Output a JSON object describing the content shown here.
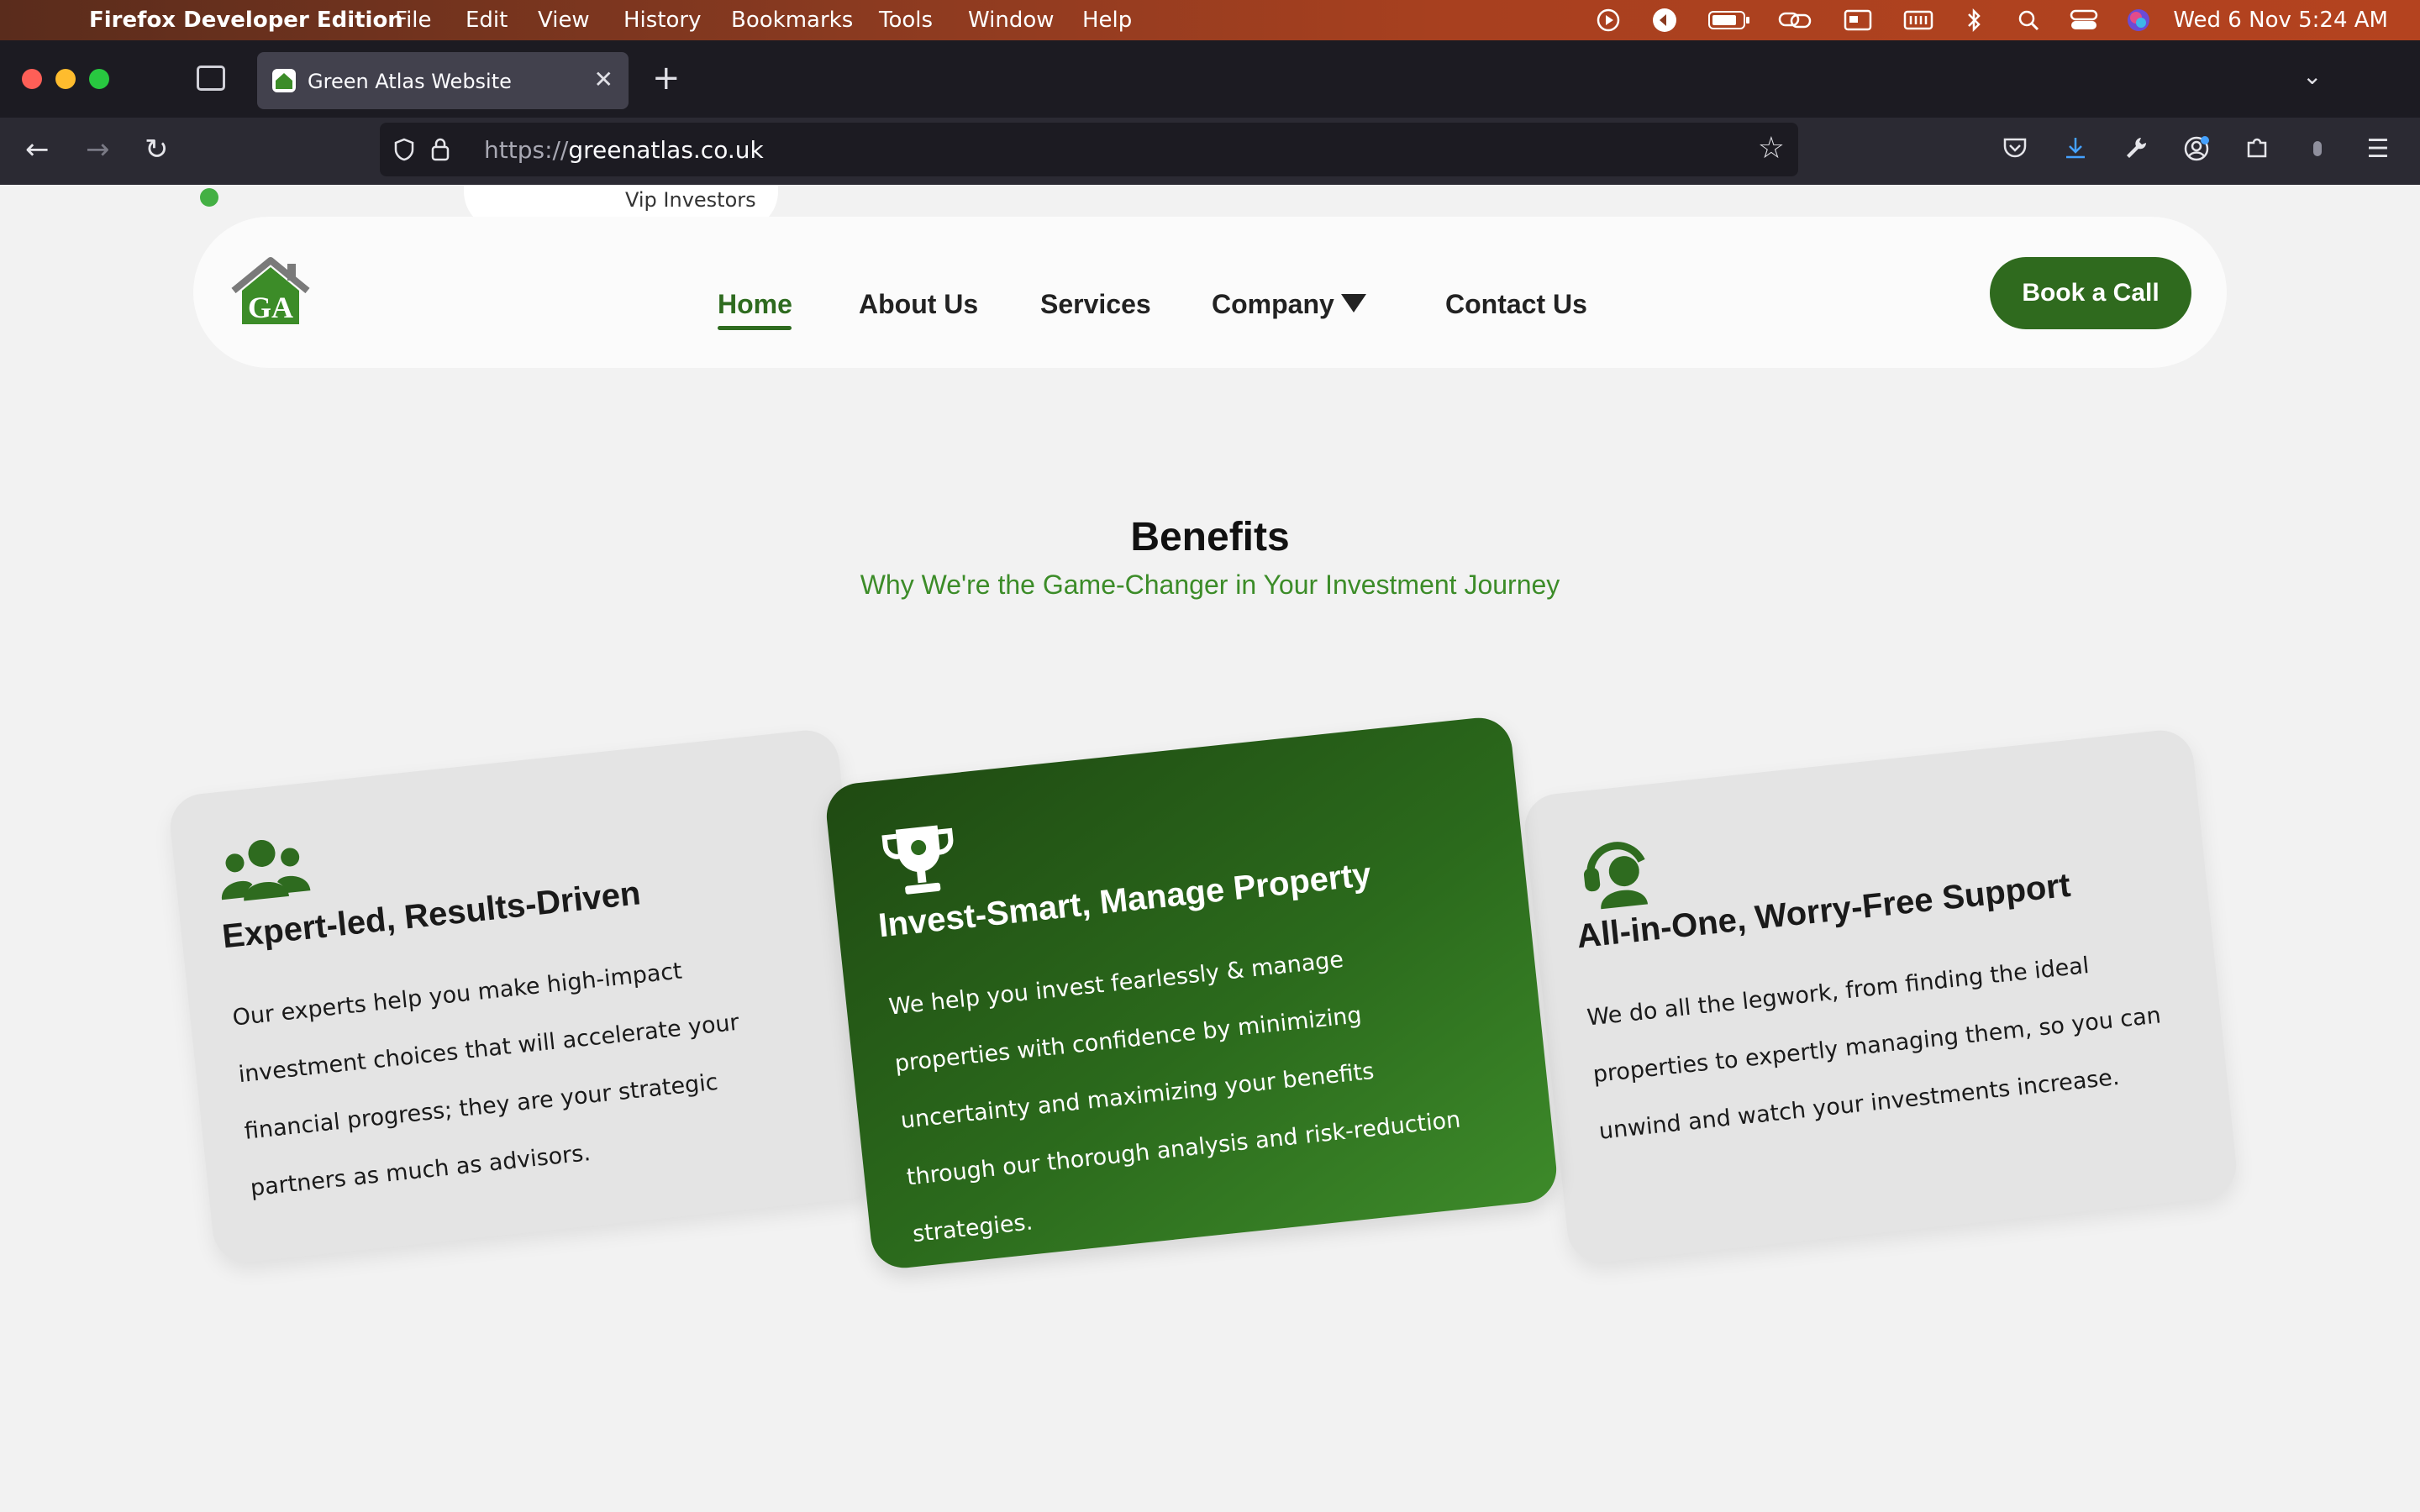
{
  "menubar": {
    "app_name": "Firefox Developer Edition",
    "items": [
      "File",
      "Edit",
      "View",
      "History",
      "Bookmarks",
      "Tools",
      "Window",
      "Help"
    ],
    "clock": "Wed 6 Nov  5:24 AM"
  },
  "browser": {
    "tab_title": "Green Atlas Website",
    "url_scheme": "https://",
    "url_host": "greenatlas.co.uk"
  },
  "site": {
    "vip_label": "Vip Investors",
    "nav": {
      "home": "Home",
      "about": "About Us",
      "services": "Services",
      "company": "Company",
      "contact": "Contact Us"
    },
    "cta": "Book a Call",
    "benefits": {
      "title": "Benefits",
      "subtitle": "Why We're the Game-Changer in Your Investment Journey"
    },
    "cards": [
      {
        "title": "Expert-led, Results-Driven",
        "body": "Our experts help you make high-impact investment choices that will accelerate your financial progress; they are your strategic partners as much as advisors.",
        "icon": "users-icon"
      },
      {
        "title": "Invest-Smart, Manage Property",
        "body": "We help you invest fearlessly & manage properties with confidence by minimizing uncertainty and maximizing your benefits through our thorough analysis and risk-reduction strategies.",
        "icon": "trophy-icon"
      },
      {
        "title": "All-in-One, Worry-Free Support",
        "body": "We do all the legwork, from finding the ideal properties to expertly managing them, so you can unwind and watch your investments increase.",
        "icon": "headset-icon"
      }
    ]
  },
  "colors": {
    "brand_green": "#2f6a1e",
    "accent_green": "#3c8c28"
  }
}
